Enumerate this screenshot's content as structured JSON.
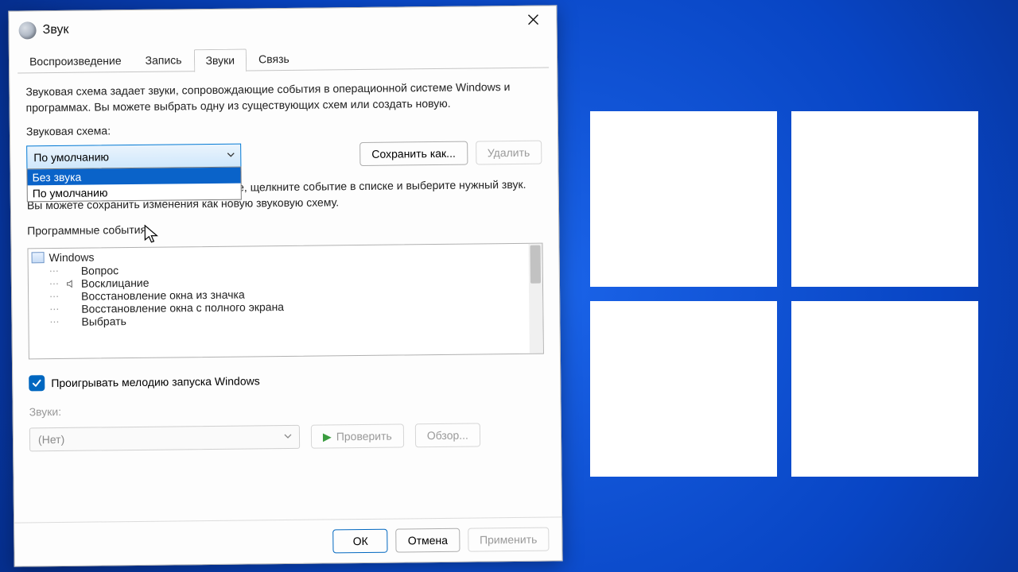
{
  "window": {
    "title": "Звук"
  },
  "tabs": {
    "playback": "Воспроизведение",
    "record": "Запись",
    "sounds": "Звуки",
    "connection": "Связь"
  },
  "description": "Звуковая схема задает звуки, сопровождающие события в операционной системе Windows и программах. Вы можете выбрать одну из существующих схем или создать новую.",
  "scheme": {
    "label": "Звуковая схема:",
    "selected": "По умолчанию",
    "options": {
      "none": "Без звука",
      "default": "По умолчанию"
    },
    "save_as": "Сохранить как...",
    "delete": "Удалить"
  },
  "hint": "Чтобы изменить звуковое сопровождение, щелкните событие в списке и выберите нужный звук. Вы можете сохранить изменения как новую звуковую схему.",
  "events": {
    "label": "Программные события:",
    "root": "Windows",
    "items": [
      "Вопрос",
      "Восклицание",
      "Восстановление окна из значка",
      "Восстановление окна с полного экрана",
      "Выбрать"
    ]
  },
  "play_startup": "Проигрывать мелодию запуска Windows",
  "sounds_section": {
    "label": "Звуки:",
    "value": "(Нет)",
    "test": "Проверить",
    "browse": "Обзор..."
  },
  "buttons": {
    "ok": "ОК",
    "cancel": "Отмена",
    "apply": "Применить"
  }
}
